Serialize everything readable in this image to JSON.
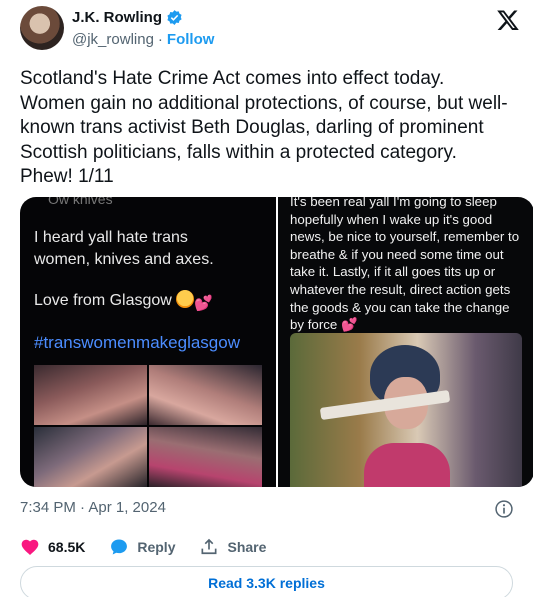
{
  "author": {
    "display_name": "J.K. Rowling",
    "handle": "@jk_rowling",
    "separator": "·",
    "follow_label": "Follow"
  },
  "tweet": {
    "text": "Scotland's Hate Crime Act comes into effect today. Women gain no additional protections, of course, but well-known trans activist Beth Douglas, darling of prominent Scottish politicians, falls within a protected category. Phew! 1/11",
    "timestamp": "7:34 PM · Apr 1, 2024"
  },
  "media": {
    "left": {
      "top_cut": "Ow knives",
      "line1": "I heard yall hate trans",
      "line2": "women, knives and axes.",
      "line3": "Love from Glasgow",
      "hashtag": "#transwomenmakeglasgow"
    },
    "right": {
      "text": "It's been real yall I'm going to sleep hopefully when I wake up it's good news, be nice to yourself, remember to breathe & if you need some time out take it. Lastly, if it all goes tits up or whatever the result, direct action gets the goods & you can take the change by force"
    }
  },
  "actions": {
    "likes": "68.5K",
    "reply_label": "Reply",
    "share_label": "Share"
  },
  "read_replies_label": "Read 3.3K replies",
  "colors": {
    "like_red": "#f91880",
    "link_blue": "#1d9bf0",
    "reply_blue": "#1d9bf0",
    "muted": "#536471"
  },
  "icons": [
    "verified-badge-icon",
    "x-logo-icon",
    "info-icon",
    "heart-icon",
    "reply-bubble-icon",
    "share-icon"
  ]
}
